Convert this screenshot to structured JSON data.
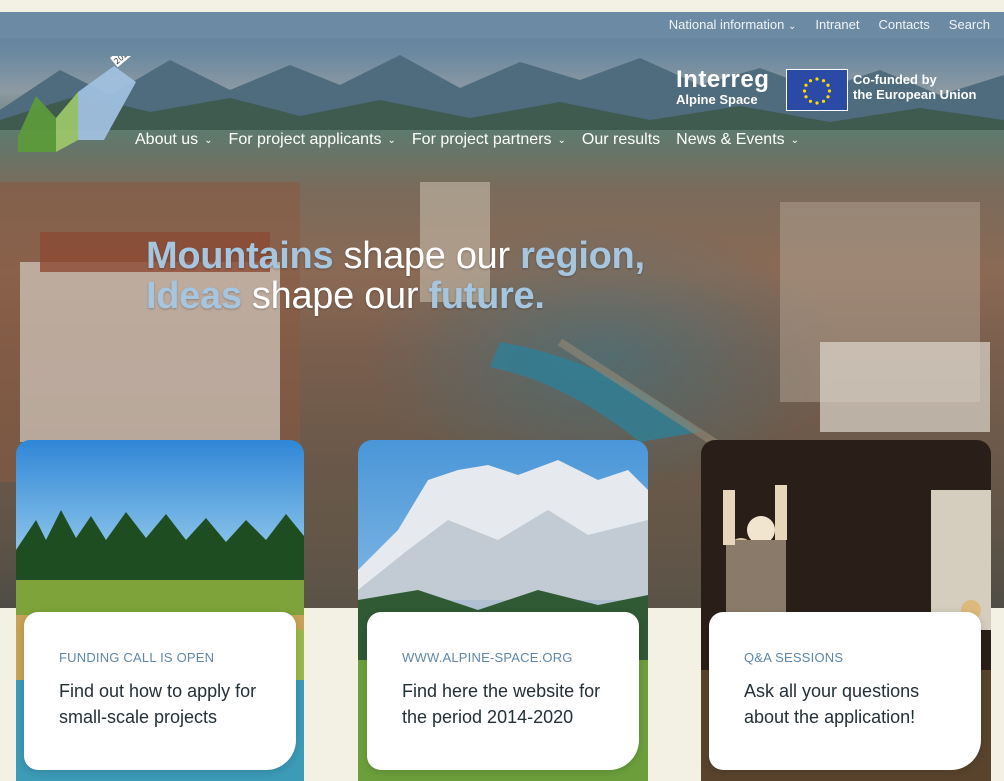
{
  "utility_nav": {
    "items": [
      {
        "label": "National information",
        "chevron": true
      },
      {
        "label": "Intranet",
        "chevron": false
      },
      {
        "label": "Contacts",
        "chevron": false
      },
      {
        "label": "Search",
        "chevron": false
      }
    ]
  },
  "logo": {
    "badge": "2027"
  },
  "interreg": {
    "title": "Interreg",
    "subtitle": "Alpine Space"
  },
  "eu": {
    "line1": "Co-funded by",
    "line2": "the European Union"
  },
  "main_nav": [
    {
      "label": "About us",
      "chevron": true
    },
    {
      "label": "For project applicants",
      "chevron": true
    },
    {
      "label": "For project partners",
      "chevron": true
    },
    {
      "label": "Our results",
      "chevron": false
    },
    {
      "label": "News & Events",
      "chevron": true
    }
  ],
  "hero": {
    "line1": {
      "a": "Mountains",
      "b": " shape our ",
      "c": "region,"
    },
    "line2": {
      "a": "Ideas",
      "b": " shape our ",
      "c": "future."
    }
  },
  "cards": [
    {
      "kicker": "FUNDING CALL IS OPEN",
      "text": "Find out how to apply for small-scale projects"
    },
    {
      "kicker": "WWW.ALPINE-SPACE.ORG",
      "text": "Find here the website for the period 2014-2020"
    },
    {
      "kicker": "Q&A SESSIONS",
      "text": "Ask all your questions about the application!"
    }
  ],
  "colors": {
    "accent_blue": "#a6c6e0",
    "kicker_blue": "#5f87a8",
    "utility_bar": "#6e8ca5",
    "eu_blue": "#2a4aa6",
    "eu_star": "#ffdd00",
    "logo_green_light": "#9bc56a",
    "logo_green_dark": "#5c9a3a",
    "logo_blue": "#9fc0df"
  },
  "icons": {
    "chevron": "chevron-down-icon"
  }
}
